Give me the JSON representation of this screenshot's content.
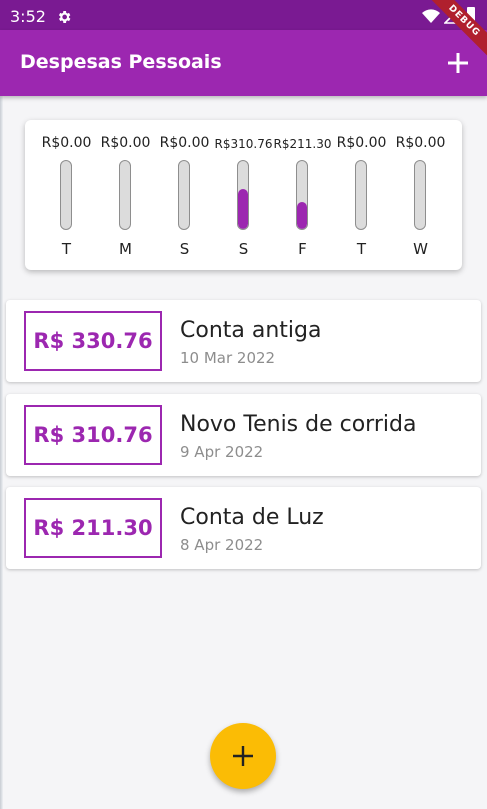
{
  "status_bar": {
    "time": "3:52"
  },
  "debug_banner": "DEBUG",
  "app_bar": {
    "title": "Despesas Pessoais"
  },
  "chart": {
    "days": [
      {
        "label": "T",
        "amount": "R$0.00",
        "fraction": 0
      },
      {
        "label": "M",
        "amount": "R$0.00",
        "fraction": 0
      },
      {
        "label": "S",
        "amount": "R$0.00",
        "fraction": 0
      },
      {
        "label": "S",
        "amount": "R$310.76",
        "fraction": 0.59
      },
      {
        "label": "F",
        "amount": "R$211.30",
        "fraction": 0.4
      },
      {
        "label": "T",
        "amount": "R$0.00",
        "fraction": 0
      },
      {
        "label": "W",
        "amount": "R$0.00",
        "fraction": 0
      }
    ]
  },
  "transactions": [
    {
      "value": "R$ 330.76",
      "title": "Conta antiga",
      "date": "10 Mar 2022"
    },
    {
      "value": "R$ 310.76",
      "title": "Novo Tenis de corrida",
      "date": "9 Apr 2022"
    },
    {
      "value": "R$ 211.30",
      "title": "Conta de Luz",
      "date": "8 Apr 2022"
    }
  ],
  "colors": {
    "primary": "#9c27b0",
    "status_bar": "#7a1a92",
    "accent": "#fbbc05",
    "debug": "#b0202e"
  },
  "icons": {
    "settings": "gear-icon",
    "add": "plus-icon",
    "wifi": "wifi-icon",
    "signal": "signal-icon",
    "battery": "battery-icon"
  }
}
